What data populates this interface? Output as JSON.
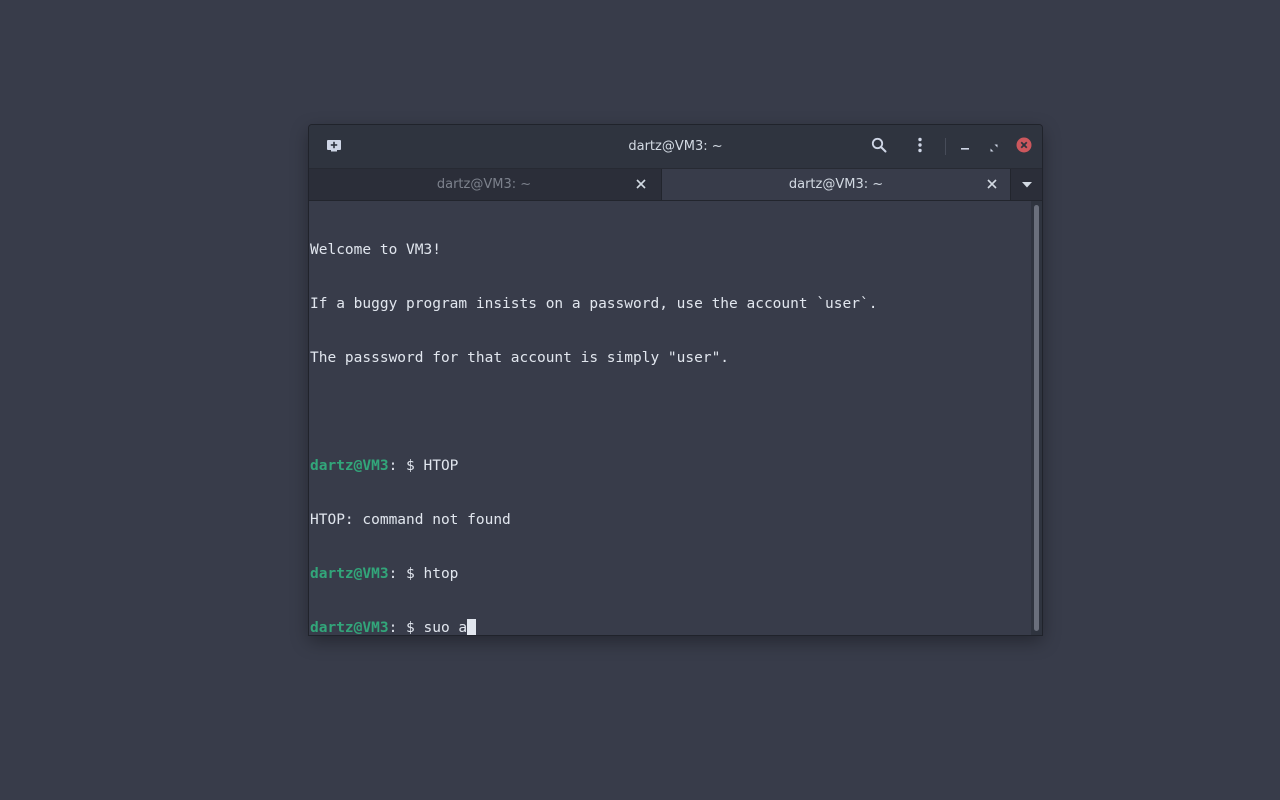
{
  "window": {
    "title": "dartz@VM3: ~"
  },
  "headerbar": {
    "new_tab_icon": "new-tab-icon",
    "search_icon": "search-icon",
    "menu_icon": "kebab-menu-icon",
    "minimize_icon": "minimize-icon",
    "maximize_icon": "maximize-icon",
    "close_icon": "close-icon",
    "close_color": "#cc575d"
  },
  "tabs": [
    {
      "label": "dartz@VM3: ~",
      "active": false
    },
    {
      "label": "dartz@VM3: ~",
      "active": true
    }
  ],
  "terminal": {
    "lines": [
      {
        "text": "Welcome to VM3!"
      },
      {
        "text": "If a buggy program insists on a password, use the account `user`."
      },
      {
        "text": "The passsword for that account is simply \"user\"."
      },
      {
        "text": ""
      },
      {
        "prompt": "dartz@VM3",
        "rest": ": $ HTOP"
      },
      {
        "text": "HTOP: command not found"
      },
      {
        "prompt": "dartz@VM3",
        "rest": ": $ htop"
      },
      {
        "prompt": "dartz@VM3",
        "rest": ": $ suo a"
      }
    ],
    "prompt_color": "#32a67a",
    "text_color": "#e1e6ee"
  },
  "colors": {
    "desktop": "#383c4a",
    "headerbar": "#2f343f",
    "tabbar": "#2b2e39"
  }
}
